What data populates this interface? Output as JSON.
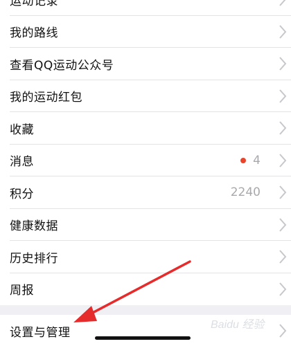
{
  "menu": {
    "items": [
      {
        "label": "运动记录"
      },
      {
        "label": "我的路线"
      },
      {
        "label": "查看QQ运动公众号"
      },
      {
        "label": "我的运动红包"
      },
      {
        "label": "收藏"
      },
      {
        "label": "消息",
        "value": "4",
        "has_dot": true
      },
      {
        "label": "积分",
        "value": "2240"
      },
      {
        "label": "健康数据"
      },
      {
        "label": "历史排行"
      },
      {
        "label": "周报"
      }
    ],
    "settings": {
      "label": "设置与管理"
    }
  },
  "watermark": {
    "text": "Baidu 经验"
  },
  "colors": {
    "accent_dot": "#e8452c",
    "arrow": "#e52b2b",
    "chevron": "#c7c7cc"
  },
  "icons": {
    "row_arrow": "chevron-right-icon"
  }
}
